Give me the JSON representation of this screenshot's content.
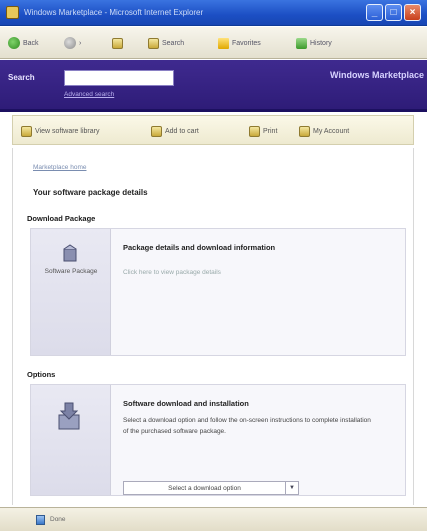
{
  "window": {
    "title": "Windows Marketplace - Microsoft Internet Explorer",
    "minimize_glyph": "_",
    "maximize_glyph": "□",
    "close_glyph": "×",
    "icons": {
      "app": "ie-icon"
    }
  },
  "browser_toolbar": {
    "back": "Back",
    "forward_glyph": "›",
    "search": "Search",
    "favorites": "Favorites",
    "history": "History"
  },
  "site_header": {
    "search_label": "Search",
    "search_value": "",
    "advanced_search": "Advanced search",
    "brand": "Windows Marketplace"
  },
  "action_bar": {
    "items": [
      "View software library",
      "Add to cart",
      "Print",
      "My Account"
    ]
  },
  "content": {
    "breadcrumb": "Marketplace home",
    "heading": "Your software package details",
    "section1_title": "Download Package",
    "card1": {
      "side_label": "Software Package",
      "title": "Package details and download information",
      "subtitle": "Click here to view package details"
    },
    "section2_title": "Options",
    "card2": {
      "title": "Software download and installation",
      "description": "Select a download option and follow the on-screen instructions to complete installation of the purchased software package.",
      "select_value": "Select a download option",
      "select_arrow": "▼"
    }
  },
  "status_bar": {
    "text": "Done"
  },
  "colors": {
    "titlebar": "#1c4fc4",
    "site_header": "#2e1c78",
    "action_bar": "#eeead0"
  }
}
